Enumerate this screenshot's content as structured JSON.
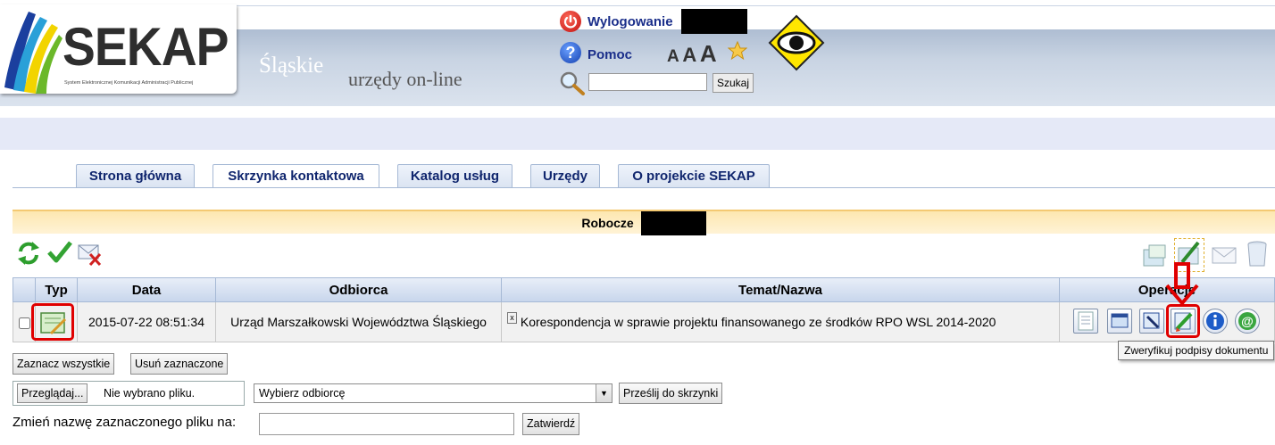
{
  "header": {
    "logo": "SEKAP",
    "logo_subtitle": "System Elektronicznej Komunikacji Administracji Publicznej",
    "site_name": "Śląskie",
    "site_tagline": "urzędy on-line",
    "logout_label": "Wylogowanie",
    "help_label": "Pomoc",
    "font_size_a1": "A",
    "font_size_a2": "A",
    "font_size_a3": "A",
    "search_placeholder": "",
    "search_button": "Szukaj"
  },
  "tabs": [
    {
      "label": "Strona główna",
      "active": false
    },
    {
      "label": "Skrzynka kontaktowa",
      "active": true
    },
    {
      "label": "Katalog usług",
      "active": false
    },
    {
      "label": "Urzędy",
      "active": false
    },
    {
      "label": "O projekcie SEKAP",
      "active": false
    }
  ],
  "section": {
    "title": "Robocze"
  },
  "table": {
    "columns": [
      "Typ",
      "Data",
      "Odbiorca",
      "Temat/Nazwa",
      "Operacje"
    ],
    "rows": [
      {
        "date": "2015-07-22 08:51:34",
        "recipient": "Urząd Marszałkowski Województwa Śląskiego",
        "subject": "Korespondencja w sprawie projektu finansowanego ze środków RPO WSL 2014-2020"
      }
    ]
  },
  "tooltip": "Zweryfikuj podpisy dokumentu",
  "buttons": {
    "select_all": "Zaznacz wszystkie",
    "delete_selected": "Usuń zaznaczone",
    "browse": "Przeglądaj...",
    "no_file": "Nie wybrano pliku.",
    "choose_recipient": "Wybierz odbiorcę",
    "send_to_box": "Prześlij do skrzynki",
    "rename_label": "Zmień nazwę zaznaczonego pliku na:",
    "confirm": "Zatwierdź"
  },
  "colors": {
    "accent": "#1a2e8a",
    "highlight": "#e00000",
    "section_bar": "#fde7b0"
  }
}
